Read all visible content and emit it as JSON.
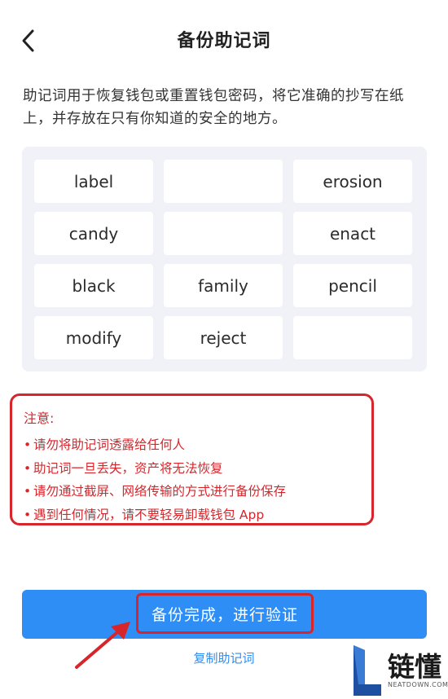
{
  "header": {
    "title": "备份助记词",
    "back_icon": "chevron-left-icon"
  },
  "description": "助记词用于恢复钱包或重置钱包密码，将它准确的抄写在纸上，并存放在只有你知道的安全的地方。",
  "mnemonic": {
    "words": [
      "label",
      "",
      "erosion",
      "candy",
      "",
      "enact",
      "black",
      "family",
      "pencil",
      "modify",
      "reject",
      ""
    ]
  },
  "notice": {
    "title": "注意:",
    "items": [
      "请勿将助记词透露给任何人",
      "助记词一旦丢失，资产将无法恢复",
      "请勿通过截屏、网络传输的方式进行备份保存",
      "遇到任何情况，请不要轻易卸载钱包 App"
    ],
    "bullet": "•"
  },
  "actions": {
    "primary_label": "备份完成，进行验证",
    "copy_label": "复制助记词"
  },
  "watermark": {
    "text": "链懂",
    "sub": "NEATDOWN.COM",
    "icon": "L-logo-icon"
  },
  "colors": {
    "accent": "#2f8ef5",
    "annotation": "#d6262b",
    "grid_bg": "#f0f2f7"
  }
}
